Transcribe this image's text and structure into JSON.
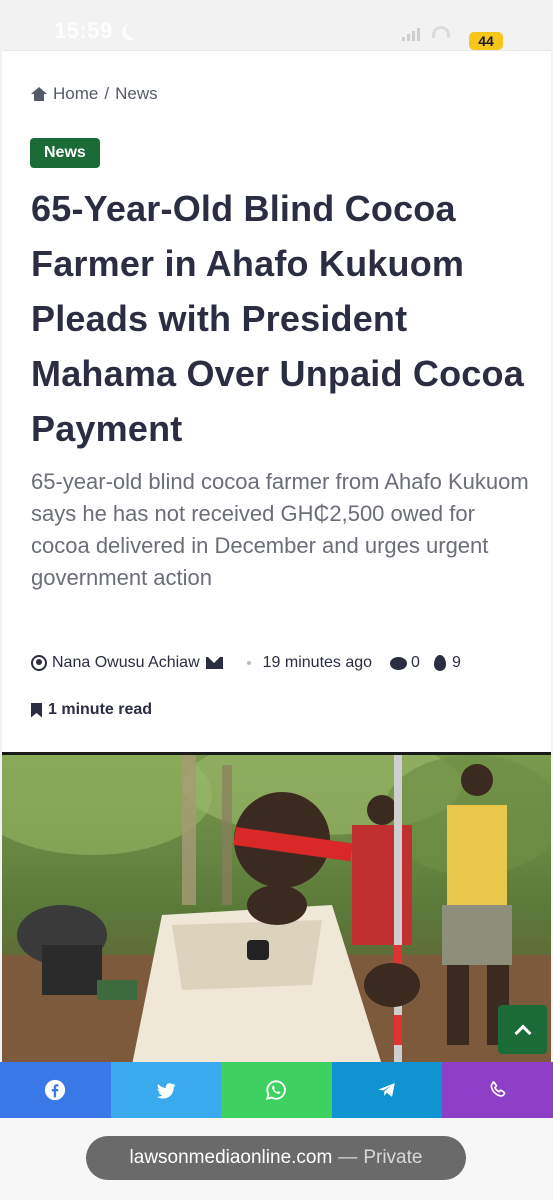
{
  "status_bar": {
    "time": "15:59",
    "battery": "44"
  },
  "breadcrumb": {
    "home": "Home",
    "separator": "/",
    "section": "News"
  },
  "article": {
    "category": "News",
    "headline": "65-Year-Old Blind Cocoa Farmer in Ahafo Kukuom Pleads with President Mahama Over Unpaid Cocoa Payment",
    "excerpt": "65-year-old blind cocoa farmer from Ahafo Kukuom says he has not received GH₵2,500 owed for cocoa delivered in December and urges urgent government action",
    "author": "Nana Owusu Achiaw",
    "posted": "19 minutes ago",
    "comments": "0",
    "views": "9",
    "read_time": "1 minute read"
  },
  "share_bar": {
    "buttons": [
      "facebook",
      "twitter",
      "whatsapp",
      "telegram",
      "phone"
    ]
  },
  "browser": {
    "url": "lawsonmediaonline.com",
    "dash": "—",
    "mode": "Private"
  },
  "colors": {
    "accent_green": "#1a6b36",
    "facebook": "#3b78e7",
    "twitter": "#3aaaee",
    "whatsapp": "#3fd160",
    "telegram": "#0f93d1",
    "phone": "#8d3fc7"
  }
}
